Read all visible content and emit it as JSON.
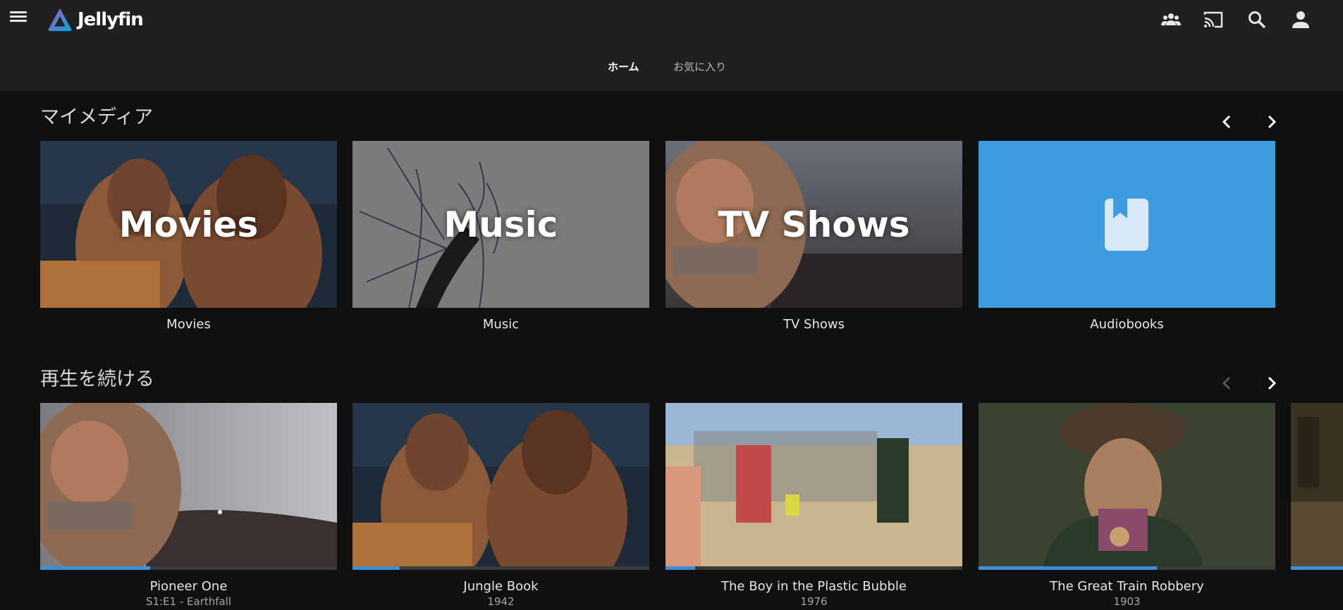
{
  "app": {
    "name": "Jellyfin"
  },
  "header": {
    "tabs": [
      {
        "label": "ホーム",
        "active": true
      },
      {
        "label": "お気に入り",
        "active": false
      }
    ],
    "icons": [
      "menu-icon",
      "users-icon",
      "cast-icon",
      "search-icon",
      "user-icon"
    ]
  },
  "my_media": {
    "title": "マイメディア",
    "items": [
      {
        "overlay": "Movies",
        "label": "Movies"
      },
      {
        "overlay": "Music",
        "label": "Music"
      },
      {
        "overlay": "TV Shows",
        "label": "TV Shows"
      },
      {
        "overlay": "",
        "label": "Audiobooks",
        "icon": "book-icon"
      }
    ]
  },
  "continue_watching": {
    "title": "再生を続ける",
    "items": [
      {
        "label": "Pioneer One",
        "sub": "S1:E1 - Earthfall",
        "progress": 0.37
      },
      {
        "label": "Jungle Book",
        "sub": "1942",
        "progress": 0.16
      },
      {
        "label": "The Boy in the Plastic Bubble",
        "sub": "1976",
        "progress": 0.1
      },
      {
        "label": "The Great Train Robbery",
        "sub": "1903",
        "progress": 0.6
      }
    ]
  },
  "colors": {
    "accent": "#3b8fd6",
    "audiobook_bg": "#3d9ddf",
    "header_bg": "#202020",
    "page_bg": "#101010"
  }
}
